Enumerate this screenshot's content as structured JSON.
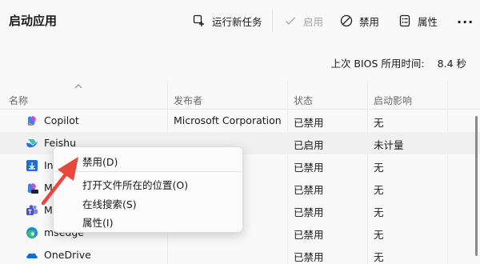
{
  "header": {
    "title": "启动应用",
    "run_task_label": "运行新任务",
    "enable_label": "启用",
    "disable_label": "禁用",
    "properties_label": "属性",
    "more_label": "···"
  },
  "boot_time": {
    "label": "上次 BIOS 所用时间:",
    "value": "8.4 秒"
  },
  "columns": {
    "name": "名称",
    "publisher": "发布者",
    "status": "状态",
    "impact": "启动影响"
  },
  "rows": [
    {
      "name": "Copilot",
      "publisher": "Microsoft Corporation",
      "status": "已禁用",
      "impact": "无",
      "icon": "copilot-icon"
    },
    {
      "name": "Feishu",
      "publisher": "",
      "status": "已启用",
      "impact": "未计量",
      "icon": "feishu-icon"
    },
    {
      "name": "In",
      "publisher": "",
      "status": "已禁用",
      "impact": "无",
      "icon": "installer-icon"
    },
    {
      "name": "M",
      "publisher": "orporation",
      "status": "已禁用",
      "impact": "无",
      "icon": "copilot-new-icon"
    },
    {
      "name": "M",
      "publisher": "",
      "status": "已禁用",
      "impact": "无",
      "icon": "teams-icon"
    },
    {
      "name": "msedge",
      "publisher": "",
      "status": "已禁用",
      "impact": "无",
      "icon": "edge-icon"
    },
    {
      "name": "OneDrive",
      "publisher": "",
      "status": "已禁用",
      "impact": "无",
      "icon": "onedrive-icon"
    }
  ],
  "context_menu": {
    "disable": "禁用(D)",
    "open_location": "打开文件所在的位置(O)",
    "search_online": "在线搜索(S)",
    "properties": "属性(I)"
  },
  "colors": {
    "accent": "#0067c0",
    "arrow": "#e8473c",
    "disabled_text": "#a6a6a6"
  }
}
